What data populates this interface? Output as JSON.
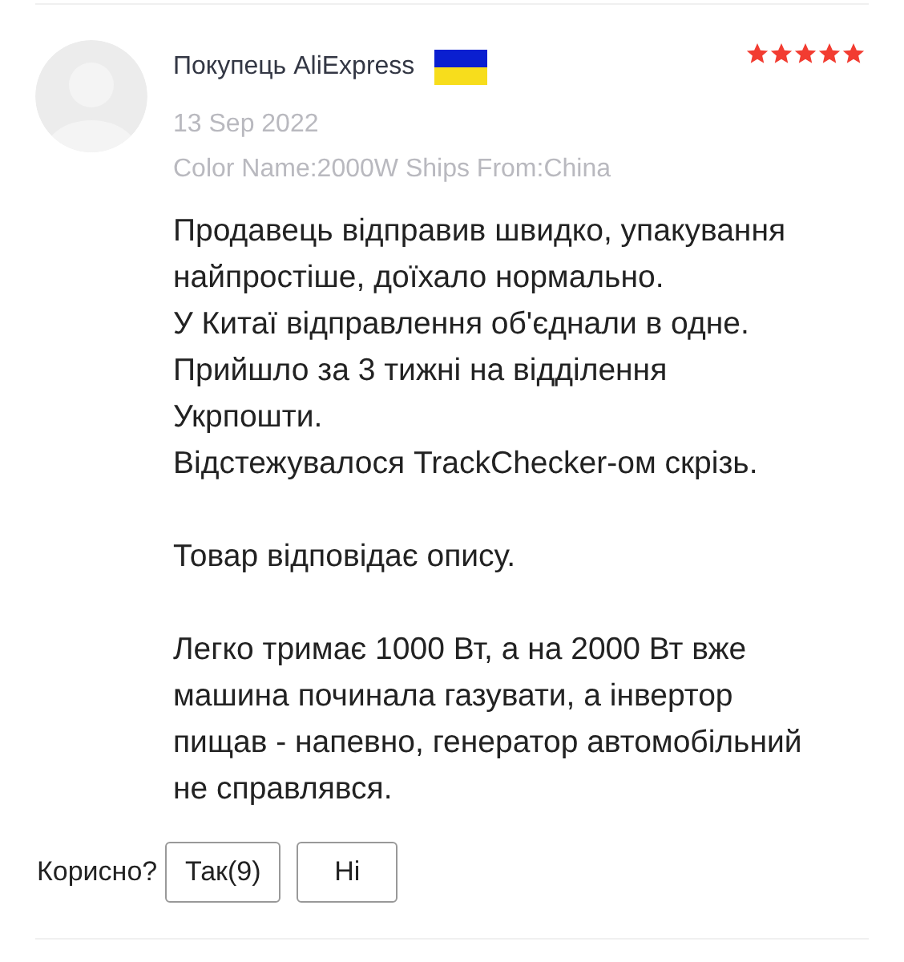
{
  "review": {
    "author": "Покупець AliExpress",
    "stars": 5,
    "date": "13 Sep 2022",
    "attributes": "Color Name:2000W Ships From:China",
    "paragraphs": [
      [
        "Продавець відправив швидко, упакування",
        "найпростіше, доїхало нормально.",
        "У Китаї відправлення об'єднали в одне.",
        "Прийшло за 3 тижні на відділення",
        "Укрпошти.",
        "Відстежувалося TrackChecker-ом скрізь."
      ],
      [
        "Товар відповідає опису."
      ],
      [
        "Легко тримає 1000 Вт, а на 2000 Вт вже",
        "машина починала газувати, а інвертор",
        "пищав - напевно, генератор автомобільний",
        "не справлявся."
      ]
    ]
  },
  "helpful": {
    "label": "Корисно?",
    "buttons": [
      "Так(9)",
      "Ні"
    ]
  }
}
